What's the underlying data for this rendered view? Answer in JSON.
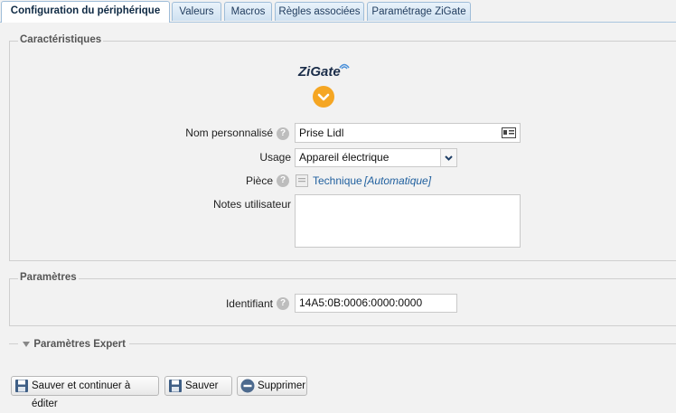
{
  "tabs": [
    {
      "label": "Configuration du périphérique",
      "active": true
    },
    {
      "label": "Valeurs"
    },
    {
      "label": "Macros"
    },
    {
      "label": "Règles associées"
    },
    {
      "label": "Paramétrage ZiGate"
    }
  ],
  "characteristics": {
    "legend": "Caractéristiques",
    "logo_text": "ZiGate",
    "name_label": "Nom personnalisé",
    "name_value": "Prise Lidl",
    "usage_label": "Usage",
    "usage_value": "Appareil électrique",
    "room_label": "Pièce",
    "room_value": "Technique",
    "room_auto": "[Automatique]",
    "notes_label": "Notes utilisateur",
    "notes_value": ""
  },
  "params": {
    "legend": "Paramètres",
    "id_label": "Identifiant",
    "id_value": "14A5:0B:0006:0000:0000"
  },
  "expert": {
    "legend": "Paramètres Expert"
  },
  "buttons": {
    "save_continue": "Sauver et continuer à éditer",
    "save": "Sauver",
    "delete": "Supprimer"
  },
  "colors": {
    "accent": "#f5a623",
    "link": "#1f5f9e",
    "tab_border": "#9fbdd8"
  },
  "icons": [
    "help-icon",
    "contact-card-icon",
    "chevron-down-icon",
    "room-icon",
    "save-icon",
    "delete-icon"
  ]
}
